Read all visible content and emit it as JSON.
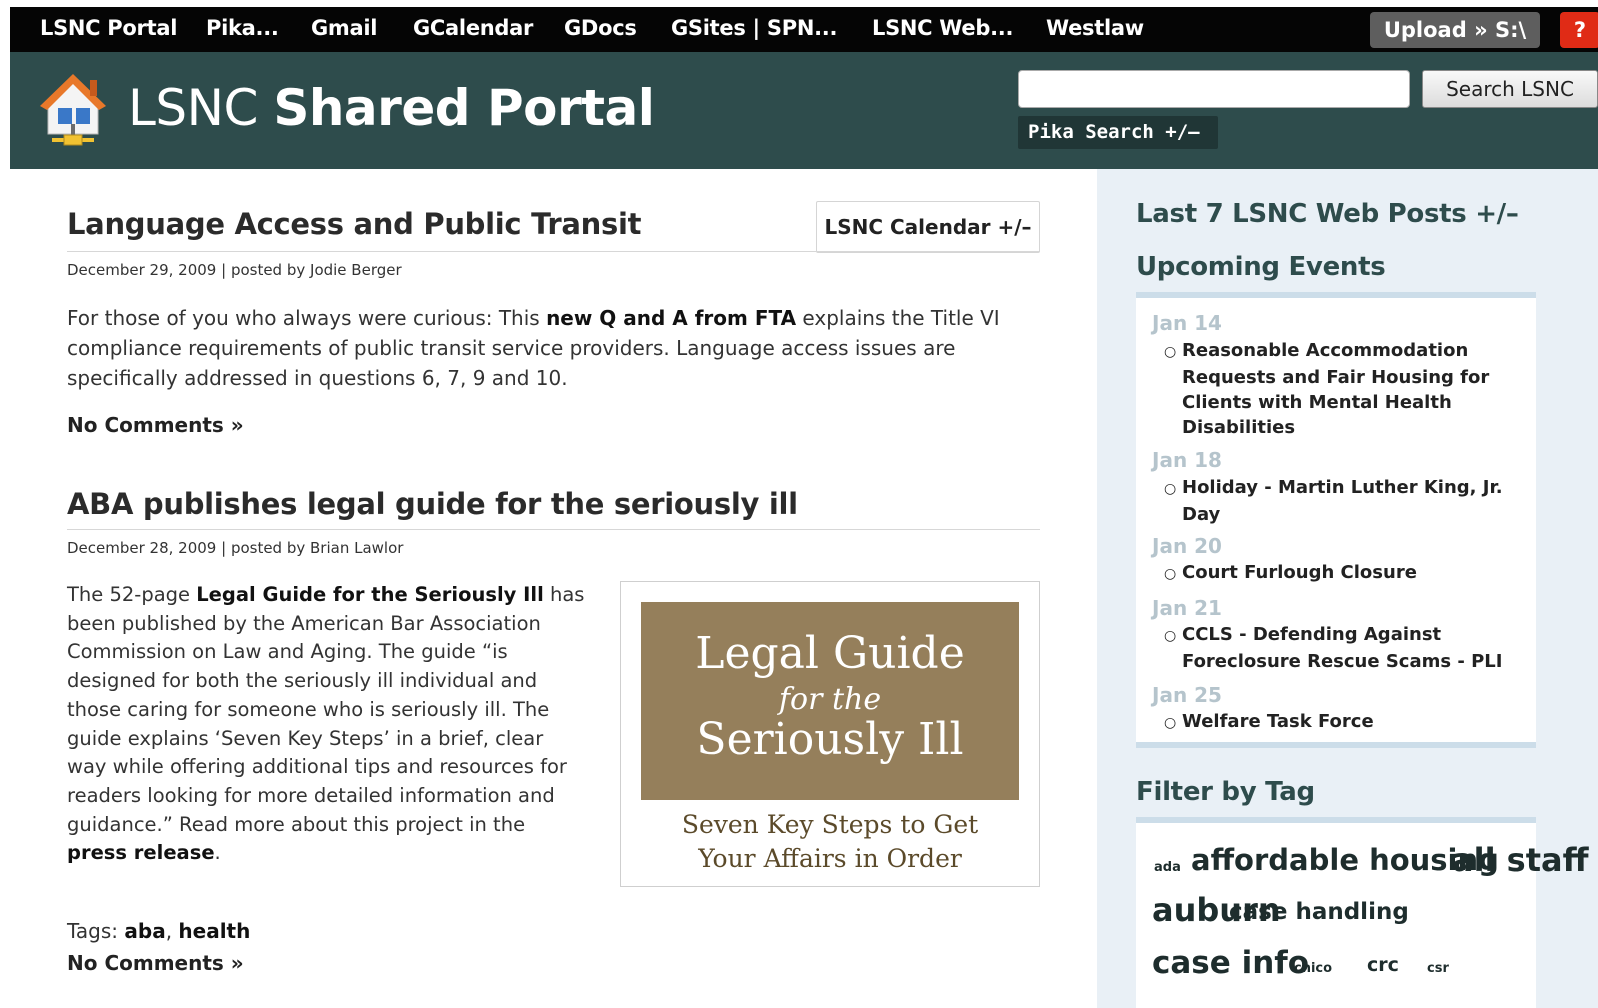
{
  "topbar": {
    "links": [
      "LSNC Portal",
      "Pika...",
      "Gmail",
      "GCalendar",
      "GDocs",
      "GSites | SPN...",
      "LSNC Web...",
      "Westlaw"
    ],
    "upload_label": "Upload » S:\\",
    "help_label": "?"
  },
  "header": {
    "title_light": "LSNC",
    "title_bold": "Shared Portal",
    "search_placeholder": "",
    "search_button": "Search LSNC",
    "pika_search": "Pika Search +/–"
  },
  "calendar_toggle": "LSNC Calendar +/–",
  "posts": [
    {
      "title": "Language Access and Public Transit",
      "meta": "December 29, 2009 | posted by Jodie Berger",
      "body_pre": "For those of you who always were curious: This ",
      "body_bold": "new Q and A from FTA",
      "body_post": " explains the Title VI compliance requirements of public transit service providers. Language access issues are specifically addressed in questions 6, 7, 9 and 10.",
      "comments": "No Comments »"
    },
    {
      "title": "ABA publishes legal guide for the seriously ill",
      "meta": "December 28, 2009 | posted by Brian Lawlor",
      "body_pre": "The 52-page ",
      "body_bold": "Legal Guide for the Seriously Ill",
      "body_mid": " has been published by the American Bar Association Commission on Law and Aging. The guide “is designed for both the seriously ill individual and those caring for someone who is seriously ill. The guide explains ‘Seven Key Steps’ in a brief, clear way while offering additional tips and resources for readers looking for more detailed information and guidance.” Read more about this project in the ",
      "body_link": "press release",
      "body_end": ".",
      "tags_label": "Tags: ",
      "tag1": "aba",
      "tag_sep": ", ",
      "tag2": "health",
      "comments": "No Comments »"
    }
  ],
  "book": {
    "line1": "Legal Guide",
    "line2": "for the",
    "line3": "Seriously Ill",
    "caption1": "Seven Key Steps to Get",
    "caption2": "Your Affairs in Order"
  },
  "sidebar": {
    "web_posts_heading": "Last 7 LSNC Web Posts +/–",
    "events_heading": "Upcoming Events",
    "events": [
      {
        "date": "Jan 14",
        "title": "Reasonable Accommodation Requests and Fair Housing for Clients with Mental Health Disabilities"
      },
      {
        "date": "Jan 18",
        "title": "Holiday - Martin Luther King, Jr. Day"
      },
      {
        "date": "Jan 20",
        "title": "Court Furlough Closure"
      },
      {
        "date": "Jan 21",
        "title": "CCLS - Defending Against Foreclosure Rescue Scams - PLI"
      },
      {
        "date": "Jan 25",
        "title": "Welfare Task Force"
      }
    ],
    "filter_heading": "Filter by Tag",
    "tags": [
      "ada",
      "affordable housing",
      "all staff",
      "auburn",
      "case handling",
      "case info",
      "chico",
      "crc",
      "csr"
    ]
  }
}
